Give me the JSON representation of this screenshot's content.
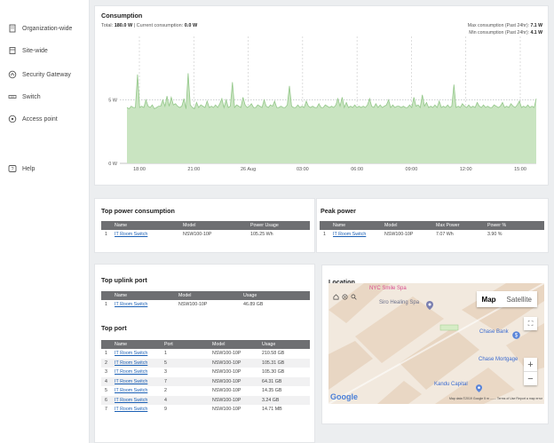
{
  "sidebar": {
    "items": [
      {
        "label": "Organization-wide",
        "icon": "building-icon"
      },
      {
        "label": "Site-wide",
        "icon": "site-icon"
      },
      {
        "label": "Security Gateway",
        "icon": "gateway-icon"
      },
      {
        "label": "Switch",
        "icon": "switch-icon"
      },
      {
        "label": "Access point",
        "icon": "access-point-icon"
      },
      {
        "label": "Help",
        "icon": "help-icon"
      }
    ]
  },
  "consumption": {
    "title": "Consumption",
    "total_label": "Total: ",
    "total_value": "180.0 W",
    "current_label": " | Current consumption: ",
    "current_value": "0.0 W",
    "max_label": "Max consumption (Past 24hr): ",
    "max_value": "7.1 W",
    "min_label": "Min consumption (Past 24hr): ",
    "min_value": "4.1 W"
  },
  "chart_data": {
    "type": "area",
    "ylabels": [
      "5 W",
      "0 W"
    ],
    "yticks": [
      5,
      0
    ],
    "ylim": [
      0,
      10
    ],
    "xlabels": [
      "18:00",
      "21:00",
      "26 Aug",
      "03:00",
      "06:00",
      "09:00",
      "12:00",
      "15:00"
    ],
    "color": "#c9e4c1",
    "line_color": "#93c789",
    "values": [
      4.4,
      4.3,
      4.5,
      4.4,
      4.4,
      7.0,
      4.4,
      4.5,
      4.4,
      5.0,
      4.5,
      4.4,
      4.6,
      4.3,
      4.4,
      4.5,
      4.5,
      5.0,
      4.5,
      5.3,
      4.5,
      5.2,
      4.6,
      4.7,
      4.5,
      4.4,
      4.5,
      5.1,
      4.3,
      7.1,
      4.6,
      4.4,
      4.3,
      4.8,
      4.4,
      4.6,
      4.5,
      4.4,
      4.9,
      4.4,
      4.5,
      4.4,
      4.6,
      4.4,
      4.7,
      5.1,
      4.4,
      5.0,
      4.4,
      4.5,
      6.4,
      4.4,
      4.6,
      4.5,
      4.4,
      5.2,
      4.6,
      4.4,
      4.5,
      4.7,
      4.4,
      4.4,
      4.6,
      4.5,
      4.4,
      5.0,
      4.5,
      4.4,
      4.6,
      4.5,
      4.9,
      4.4,
      4.4,
      4.5,
      4.4,
      4.4,
      4.6,
      6.1,
      4.5,
      4.4,
      4.4,
      4.6,
      4.4,
      4.5,
      4.4,
      4.9,
      4.5,
      4.4,
      4.5,
      4.4,
      4.4,
      4.7,
      4.4,
      4.4,
      4.6,
      4.5,
      4.4,
      4.5,
      4.4,
      4.6,
      5.1,
      4.5,
      5.2,
      4.4,
      4.8,
      4.4,
      4.5,
      4.4,
      4.6,
      4.4,
      4.5,
      4.4,
      4.5,
      4.4,
      4.6,
      5.1,
      4.5,
      4.4,
      4.7,
      4.4,
      4.6,
      4.4,
      4.5,
      4.6,
      5.0,
      4.4,
      4.6,
      4.4,
      4.5,
      4.5,
      4.4,
      4.5,
      4.4,
      4.4,
      4.6,
      4.4,
      5.2,
      4.5,
      4.6,
      4.4,
      5.4,
      4.5,
      4.8,
      4.4,
      4.5,
      4.4,
      4.6,
      4.4,
      4.9,
      4.4,
      4.5,
      4.4,
      4.6,
      4.4,
      4.5,
      6.2,
      4.4,
      4.5,
      4.4,
      4.7,
      4.5,
      4.4,
      4.6,
      4.4,
      4.5,
      4.4,
      4.8,
      4.5,
      4.4,
      4.6,
      4.4,
      4.5,
      4.4,
      4.4,
      4.6,
      4.5,
      4.4,
      4.5,
      4.8,
      4.4,
      4.5,
      4.4,
      4.7,
      4.5,
      4.4,
      4.6,
      4.9,
      4.4,
      4.5,
      4.4,
      4.6,
      4.4,
      4.5,
      4.4,
      5.1
    ]
  },
  "top_power": {
    "title": "Top power consumption",
    "headers": [
      "",
      "Name",
      "Model",
      "Power Usage"
    ],
    "rows": [
      [
        "1",
        "IT Room Switch",
        "NSW100-10P",
        "105.25 Wh"
      ]
    ]
  },
  "peak_power": {
    "title": "Peak power",
    "headers": [
      "",
      "Name",
      "Model",
      "Max Power",
      "Power %"
    ],
    "rows": [
      [
        "1",
        "IT Room Switch",
        "NSW100-10P",
        "7.07 Wh",
        "3.90 %"
      ]
    ]
  },
  "top_uplink": {
    "title": "Top uplink port",
    "headers": [
      "",
      "Name",
      "Model",
      "Usage"
    ],
    "rows": [
      [
        "1",
        "IT Room Switch",
        "NSW100-10P",
        "46.89 GB"
      ]
    ]
  },
  "top_port": {
    "title": "Top port",
    "headers": [
      "",
      "Name",
      "Port",
      "Model",
      "Usage"
    ],
    "rows": [
      [
        "1",
        "IT Room Switch",
        "1",
        "NSW100-10P",
        "210.58 GB"
      ],
      [
        "2",
        "IT Room Switch",
        "5",
        "NSW100-10P",
        "105.31 GB"
      ],
      [
        "3",
        "IT Room Switch",
        "3",
        "NSW100-10P",
        "105.30 GB"
      ],
      [
        "4",
        "IT Room Switch",
        "7",
        "NSW100-10P",
        "64.31 GB"
      ],
      [
        "5",
        "IT Room Switch",
        "2",
        "NSW100-10P",
        "14.35 GB"
      ],
      [
        "6",
        "IT Room Switch",
        "4",
        "NSW100-10P",
        "3.24 GB"
      ],
      [
        "7",
        "IT Room Switch",
        "9",
        "NSW100-10P",
        "14.71 MB"
      ]
    ]
  },
  "location": {
    "title": "Location",
    "map_btn": "Map",
    "satellite_btn": "Satellite",
    "labels": {
      "nyc_spa": "NYC Smile Spa",
      "siro_spa": "Siro Healing Spa",
      "chase_bank": "Chase Bank",
      "chase_mortgage": "Chase Mortgage",
      "kandu": "Kandu Capital"
    },
    "google": "Google",
    "attribution": "Map data ©2019 Google   5 m ⎯⎯⎯⎯   Terms of Use   Report a map error",
    "zoom_in": "+",
    "zoom_out": "−"
  },
  "colors": {
    "header_bg": "#6e6f72",
    "link": "#1a5fb4",
    "chart_fill": "#c9e4c1"
  }
}
